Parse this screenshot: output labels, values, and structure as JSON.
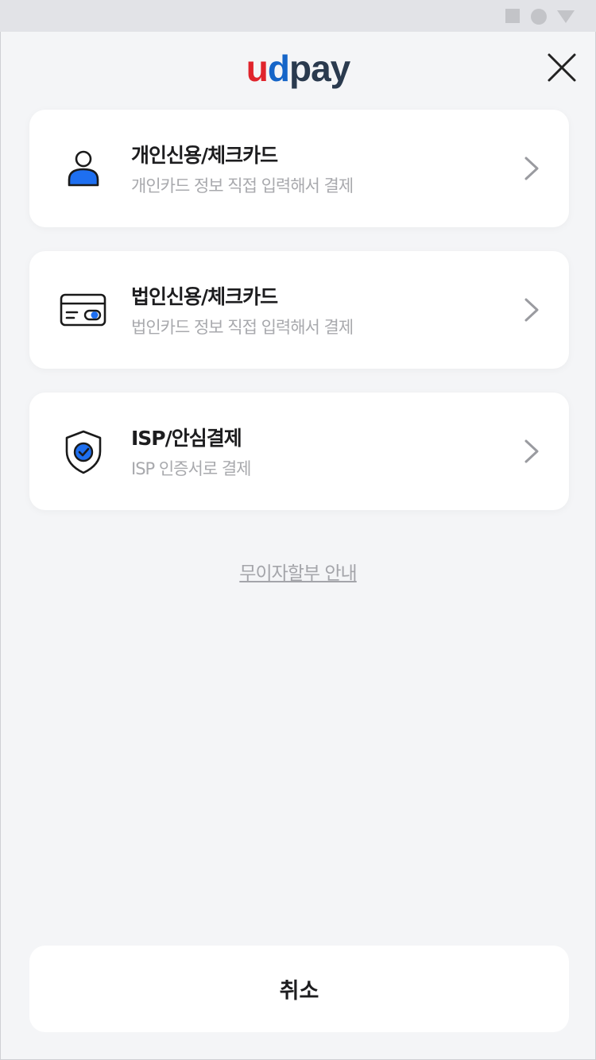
{
  "logo": {
    "part1": "u",
    "part2": "d",
    "part3": "pay"
  },
  "close": {
    "icon": "close-icon"
  },
  "options": [
    {
      "title": "개인신용/체크카드",
      "subtitle": "개인카드 정보 직접 입력해서 결제",
      "icon": "person-icon"
    },
    {
      "title": "법인신용/체크카드",
      "subtitle": "법인카드 정보 직접 입력해서 결제",
      "icon": "credit-card-icon"
    },
    {
      "title": "ISP/안심결제",
      "subtitle": "ISP 인증서로 결제",
      "icon": "shield-check-icon"
    }
  ],
  "installment_link": "무이자할부 안내",
  "cancel_label": "취소",
  "colors": {
    "brand_red": "#e0242c",
    "brand_blue": "#1565c8",
    "brand_dark": "#2a3a4e",
    "icon_blue": "#1e6ff0"
  }
}
